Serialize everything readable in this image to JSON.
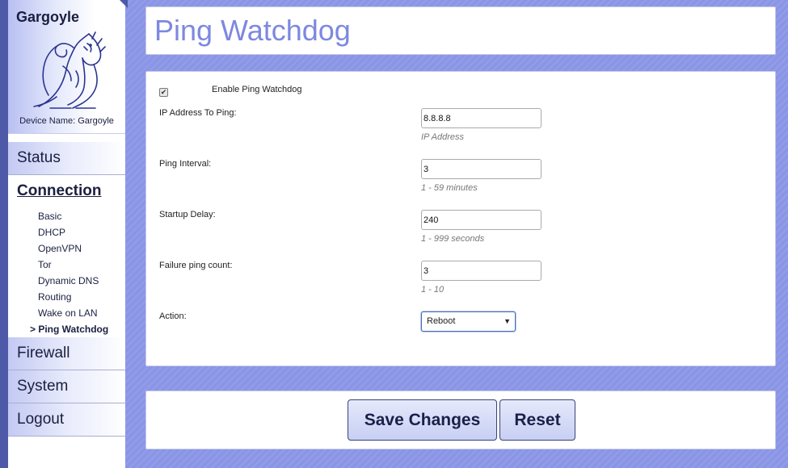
{
  "brand": {
    "name": "Gargoyle",
    "device_name": "Device Name: Gargoyle"
  },
  "nav": {
    "status": "Status",
    "connection": "Connection",
    "sub_items": [
      "Basic",
      "DHCP",
      "OpenVPN",
      "Tor",
      "Dynamic DNS",
      "Routing",
      "Wake on LAN",
      "> Ping Watchdog"
    ],
    "firewall": "Firewall",
    "system": "System",
    "logout": "Logout"
  },
  "page": {
    "title": "Ping Watchdog"
  },
  "form": {
    "enable_label": "Enable Ping Watchdog",
    "enable_checked": true,
    "ip_label": "IP Address To Ping:",
    "ip_value": "8.8.8.8",
    "ip_hint": "IP Address",
    "interval_label": "Ping Interval:",
    "interval_value": "3",
    "interval_hint": "1 - 59 minutes",
    "delay_label": "Startup Delay:",
    "delay_value": "240",
    "delay_hint": "1 - 999 seconds",
    "failure_label": "Failure ping count:",
    "failure_value": "3",
    "failure_hint": "1 - 10",
    "action_label": "Action:",
    "action_value": "Reboot"
  },
  "buttons": {
    "save": "Save Changes",
    "reset": "Reset"
  },
  "icons": {
    "checkbox": "checkmark-icon",
    "select_arrow": "triangle-down-icon",
    "logo": "gargoyle-logo-icon"
  },
  "colors": {
    "accent": "#7d88e0",
    "background": "#8a95e6",
    "text": "#1a1f40"
  }
}
